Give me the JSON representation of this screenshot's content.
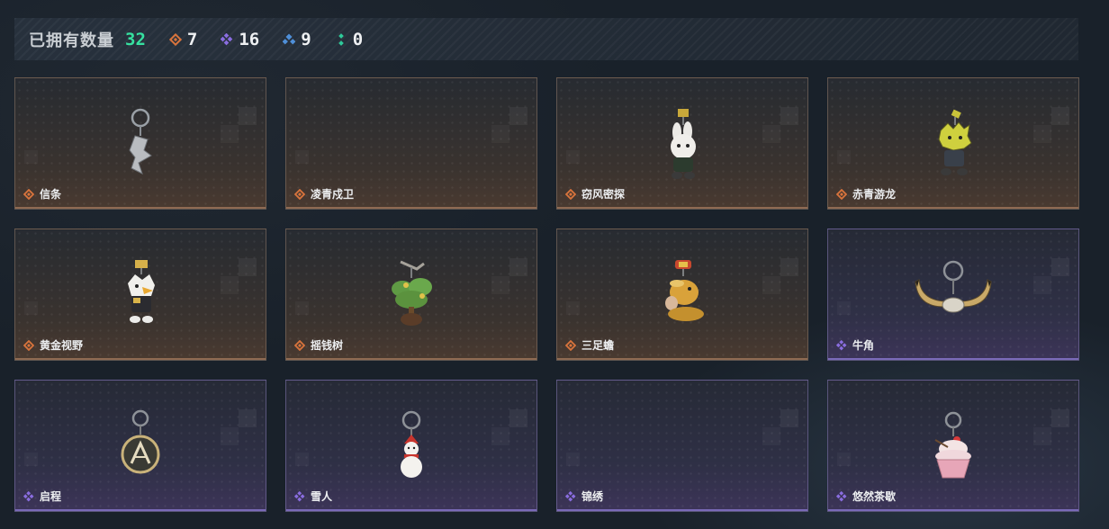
{
  "header": {
    "owned_label": "已拥有数量",
    "owned_count": "32",
    "stats": [
      {
        "rarity": "orange",
        "icon": "orange-diamond-icon",
        "color": "#d9743c",
        "value": "7"
      },
      {
        "rarity": "purple",
        "icon": "purple-diamond-icon",
        "color": "#8a6de0",
        "value": "16"
      },
      {
        "rarity": "blue",
        "icon": "blue-diamond-icon",
        "color": "#4f8fd8",
        "value": "9"
      },
      {
        "rarity": "green",
        "icon": "green-diamond-icon",
        "color": "#2fc99a",
        "value": "0"
      }
    ]
  },
  "colors": {
    "count_accent": "#36e0a0",
    "orange": "#d9743c",
    "purple": "#8a6de0"
  },
  "items": [
    {
      "name": "信条",
      "rarity": "orange",
      "art": "silver-charm-icon"
    },
    {
      "name": "凌青戍卫",
      "rarity": "orange",
      "art": "none"
    },
    {
      "name": "窃风密探",
      "rarity": "orange",
      "art": "white-rabbit-figure-icon"
    },
    {
      "name": "赤青游龙",
      "rarity": "orange",
      "art": "yellow-dragon-figure-icon"
    },
    {
      "name": "黄金视野",
      "rarity": "orange",
      "art": "golden-eagle-figure-icon"
    },
    {
      "name": "摇钱树",
      "rarity": "orange",
      "art": "money-tree-figure-icon"
    },
    {
      "name": "三足蟾",
      "rarity": "orange",
      "art": "golden-toad-figure-icon"
    },
    {
      "name": "牛角",
      "rarity": "purple",
      "art": "bull-horns-charm-icon"
    },
    {
      "name": "启程",
      "rarity": "purple",
      "art": "medallion-charm-icon"
    },
    {
      "name": "雪人",
      "rarity": "purple",
      "art": "snowman-charm-icon"
    },
    {
      "name": "锦绣",
      "rarity": "purple",
      "art": "none"
    },
    {
      "name": "悠然茶歇",
      "rarity": "purple",
      "art": "cupcake-charm-icon"
    }
  ]
}
